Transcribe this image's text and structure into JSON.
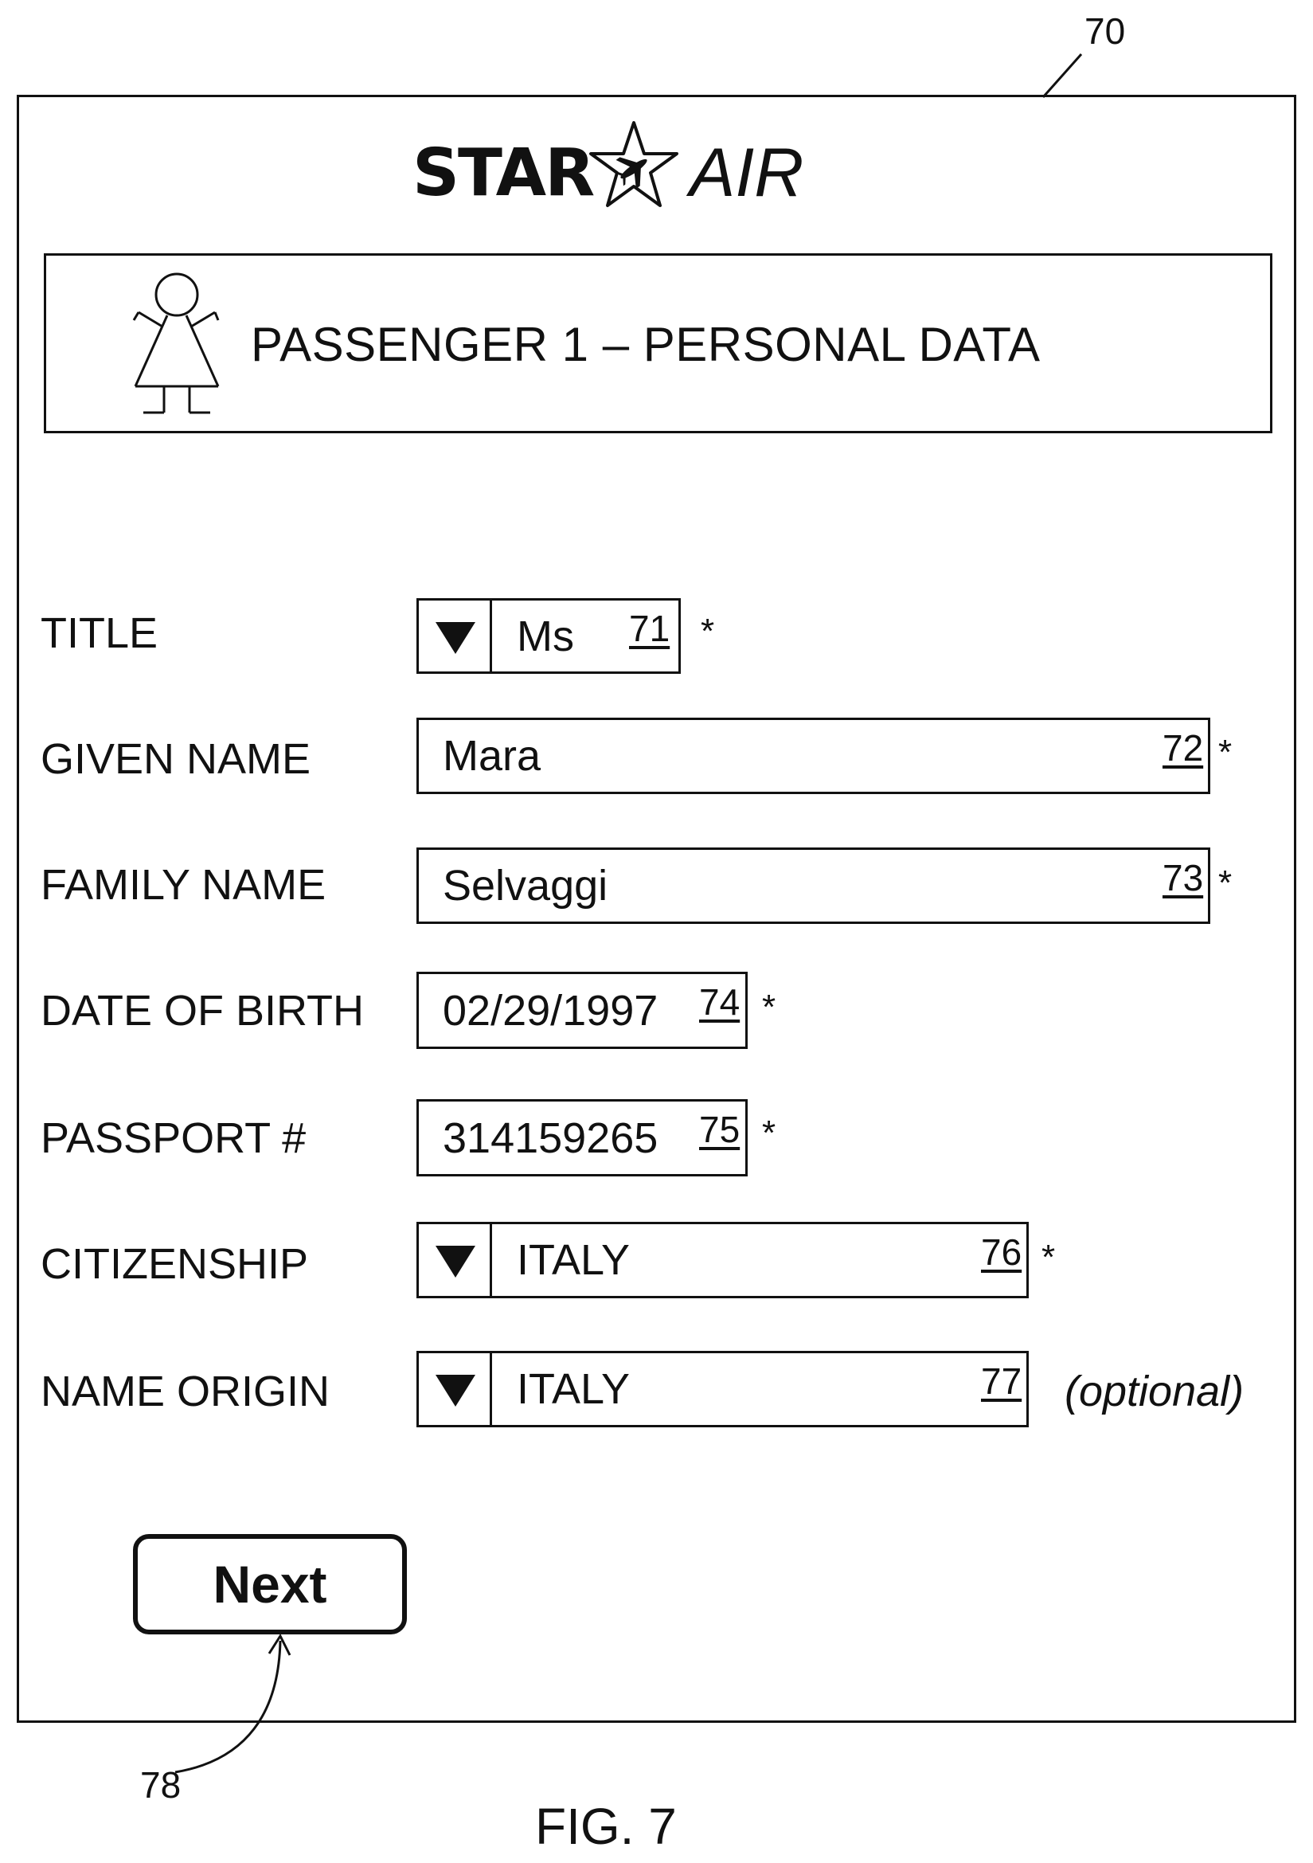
{
  "figure": {
    "ref_window": "70",
    "ref_next": "78",
    "caption": "FIG. 7"
  },
  "logo": {
    "left_word": "STAR",
    "right_word": "AIR",
    "icon": "star-with-airplane-icon"
  },
  "header": {
    "title": "PASSENGER 1 – PERSONAL DATA",
    "icon": "passenger-female-icon"
  },
  "form": {
    "title": {
      "label": "TITLE",
      "value": "Ms",
      "ref": "71",
      "required_mark": "*",
      "icon": "triangle-down-icon"
    },
    "given_name": {
      "label": "GIVEN NAME",
      "value": "Mara",
      "ref": "72",
      "required_mark": "*"
    },
    "family_name": {
      "label": "FAMILY NAME",
      "value": "Selvaggi",
      "ref": "73",
      "required_mark": "*"
    },
    "date_of_birth": {
      "label": "DATE OF BIRTH",
      "value": "02/29/1997",
      "ref": "74",
      "required_mark": "*"
    },
    "passport": {
      "label": "PASSPORT #",
      "value": "314159265",
      "ref": "75",
      "required_mark": "*"
    },
    "citizenship": {
      "label": "CITIZENSHIP",
      "value": "ITALY",
      "ref": "76",
      "required_mark": "*",
      "icon": "triangle-down-icon"
    },
    "name_origin": {
      "label": "NAME ORIGIN",
      "value": "ITALY",
      "ref": "77",
      "note": "(optional)",
      "icon": "triangle-down-icon"
    }
  },
  "actions": {
    "next_label": "Next"
  }
}
